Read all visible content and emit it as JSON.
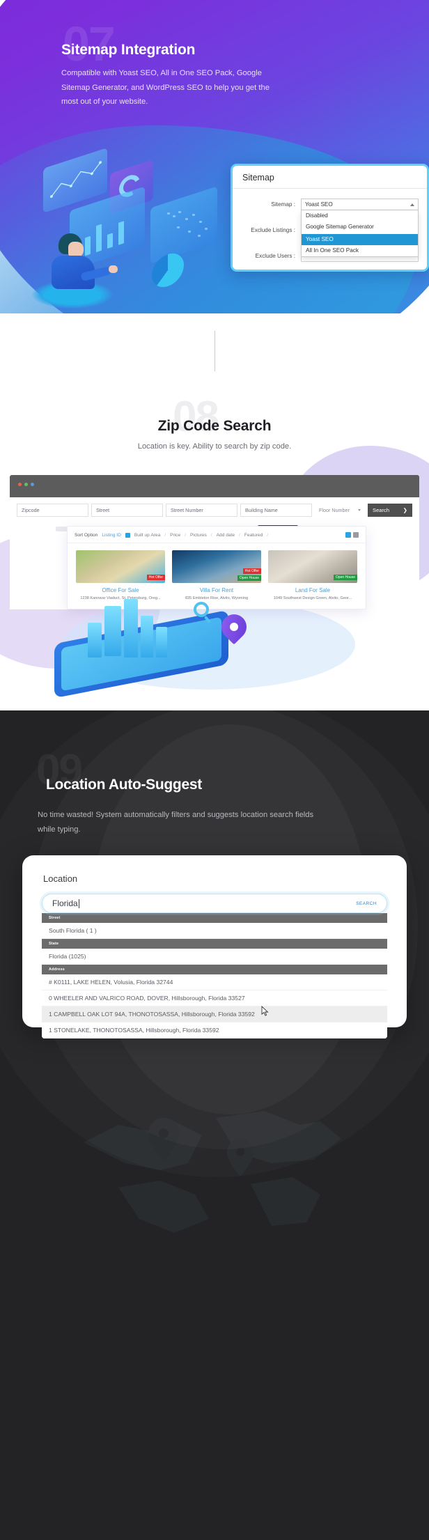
{
  "section07": {
    "number": "07",
    "heading": "Sitemap Integration",
    "paragraph": "Compatible with Yoast SEO, All in One SEO Pack, Google Sitemap Generator, and WordPress SEO to help you get the most out of your website.",
    "card": {
      "title": "Sitemap",
      "fields": [
        {
          "label": "Sitemap :",
          "value": "Yoast SEO"
        },
        {
          "label": "Exclude Listings :",
          "value": ""
        },
        {
          "label": "Exclude Users :",
          "value": ""
        }
      ],
      "dropdown_options": [
        "Disabled",
        "Google Sitemap Generator",
        "Yoast SEO",
        "All In One SEO Pack"
      ],
      "dropdown_selected": "Yoast SEO"
    }
  },
  "section08": {
    "number": "08",
    "heading": "Zip Code Search",
    "paragraph": "Location is key. Ability to search by zip code.",
    "browser": {
      "search_fields": [
        {
          "placeholder": "Zipcode"
        },
        {
          "placeholder": "Street"
        },
        {
          "placeholder": "Street Number"
        },
        {
          "placeholder": "Building Name"
        }
      ],
      "floor_select": "Floor Number",
      "search_button": "Search",
      "search_button_arrow": "❯"
    },
    "sort": {
      "label": "Sort Option",
      "options": [
        "Listing ID",
        "Built up Area",
        "Price",
        "Pictures",
        "Add date",
        "Featured"
      ],
      "separator": "/"
    },
    "listings": [
      {
        "title": "Office For Sale",
        "address": "1238 Kanowar Viaduct, St. Petersburg, Oreg...",
        "badges": [
          "Hot Offer"
        ]
      },
      {
        "title": "Villa For Rent",
        "address": "835 Embleton Rise, Alvito, Wyoming",
        "badges": [
          "Hot Offer",
          "Open House"
        ]
      },
      {
        "title": "Land For Sale",
        "address": "1049 Southwest Design Green, Alvito, Geor...",
        "badges": [
          "Open House"
        ]
      }
    ]
  },
  "section09": {
    "number": "09",
    "heading": "Location Auto-Suggest",
    "paragraph": "No time wasted! System automatically filters and suggests location search fields while typing.",
    "card": {
      "title": "Location",
      "input_value": "Florida",
      "search_label": "SEARCH",
      "groups": [
        {
          "header": "Street",
          "items": [
            "South Florida ( 1 )"
          ]
        },
        {
          "header": "State",
          "items": [
            "Florida (1025)"
          ]
        },
        {
          "header": "Address",
          "items": [
            "# K0111, LAKE HELEN, Volusia, Florida 32744",
            "0 WHEELER AND VALRICO ROAD, DOVER, Hillsborough, Florida 33527",
            "1 CAMPBELL OAK LOT 94A, THONOTOSASSA, Hillsborough, Florida 33592",
            "1 STONELAKE, THONOTOSASSA, Hillsborough, Florida 33592"
          ],
          "highlighted_index": 2
        }
      ]
    }
  },
  "colors": {
    "purple": "#7a2bd6",
    "blue": "#2aa0e0",
    "accent_cyan": "#5fd0f7",
    "dropdown_selected": "#2196d4",
    "dark_bg": "#232326",
    "badge_hot": "#e02f2f",
    "badge_open": "#1f9c3f",
    "link_blue": "#4a9fd8"
  }
}
